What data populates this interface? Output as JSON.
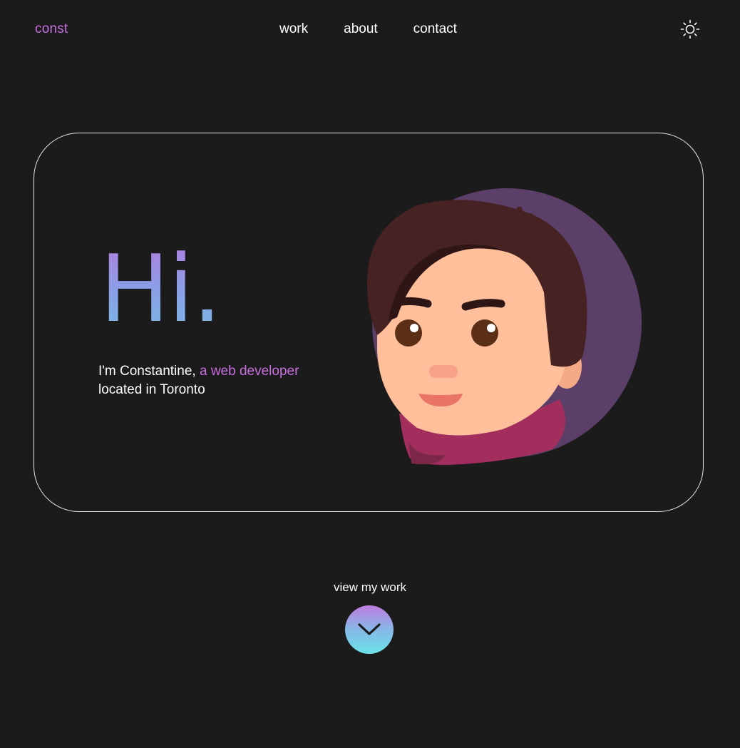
{
  "nav": {
    "logo": "const",
    "links": [
      "work",
      "about",
      "contact"
    ],
    "theme_toggle_icon": "sun-icon"
  },
  "hero": {
    "title": "Hi.",
    "intro_prefix": "I'm Constantine, ",
    "intro_accent": "a web developer",
    "intro_suffix": "located in Toronto",
    "avatar_icon": "avatar-illustration"
  },
  "cta": {
    "label": "view my work",
    "icon": "chevron-down-icon"
  },
  "colors": {
    "background": "#1b1b1b",
    "accent": "#c86fe0",
    "text": "#ffffff",
    "card_border": "#e8e8e8",
    "avatar_bg": "#5b3f68",
    "hair": "#472222",
    "skin": "#ffbf9b",
    "scarf": "#a22e5e"
  }
}
